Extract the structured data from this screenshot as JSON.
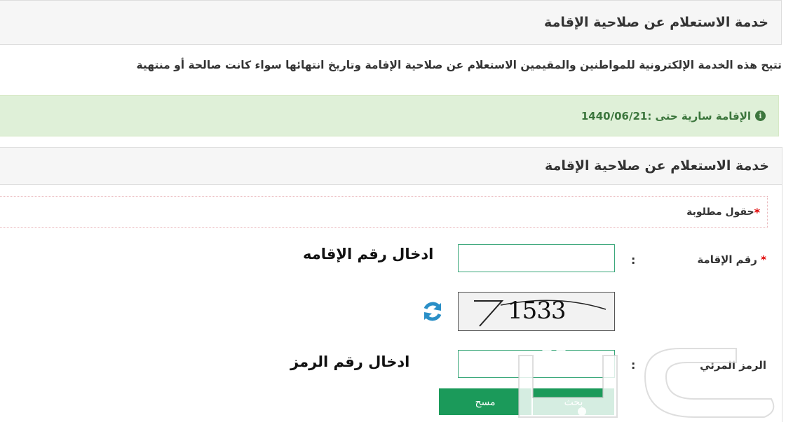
{
  "header": {
    "title": "خدمة الاستعلام عن صلاحية الإقامة"
  },
  "intro": {
    "text": "تتيح هذه الخدمة الإلكترونية للمواطنين والمقيمين الاستعلام عن صلاحية الإقامة وتاريخ انتهائها سواء كانت صالحة أو منتهية"
  },
  "alert": {
    "text": "الإقامة سارية حتى :1440/06/21",
    "icon": "info-circle-icon"
  },
  "form": {
    "title": "خدمة الاستعلام عن صلاحية الإقامة",
    "required_note": "حقول مطلوبة",
    "required_star": "*",
    "iqama_label": "رقم الإقامة",
    "iqama_value": "",
    "iqama_hint": "ادخال رقم الإقامه",
    "captcha_text": "1533",
    "captcha_label": "الرمز المرئي",
    "captcha_value": "",
    "captcha_hint": "ادخال رقم الرمز",
    "colon": ":",
    "clear_label": "مسح",
    "send_label": "بحث"
  },
  "watermark": {
    "text": "بلدنا نيوز"
  },
  "colors": {
    "accent": "#1b9a5a",
    "alert_bg": "#dff0d8",
    "alert_text": "#3c763d",
    "refresh": "#2a8fc7"
  }
}
